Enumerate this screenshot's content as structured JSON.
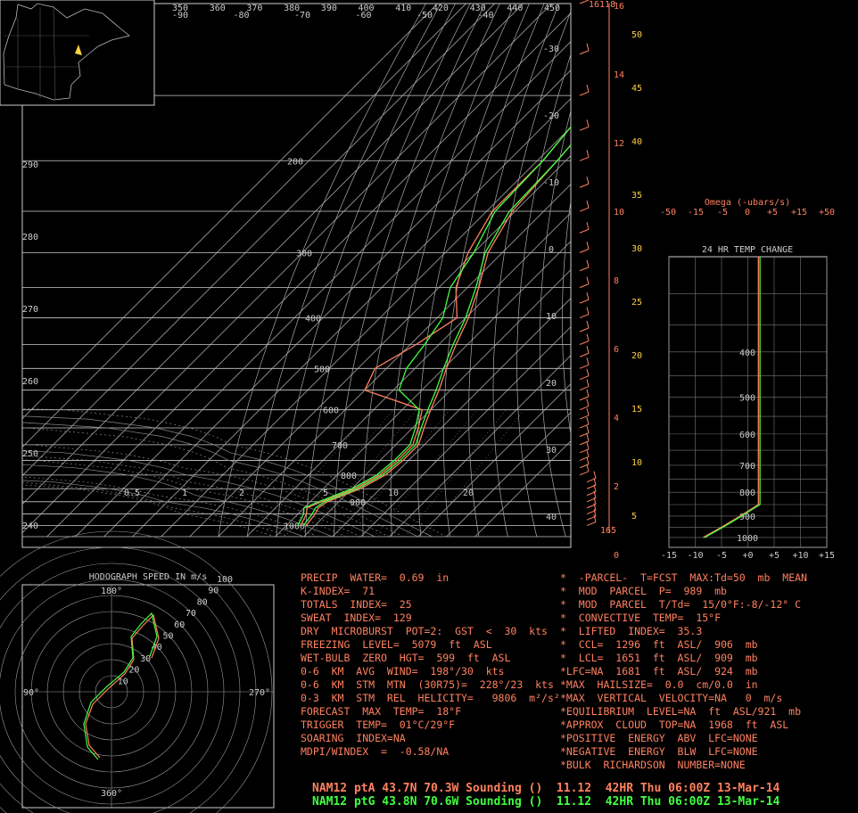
{
  "chart_data": [
    {
      "type": "line",
      "title": "",
      "kind": "skew-T log-P sounding",
      "top_temp_labels": [
        "350",
        "360",
        "370",
        "380",
        "390",
        "400",
        "410",
        "420",
        "430",
        "440",
        "450"
      ],
      "top_c_labels": [
        "-90",
        "-80",
        "-70",
        "-60",
        "-50",
        "-40"
      ],
      "theta_labels": [
        "290",
        "280",
        "270",
        "260",
        "250",
        "240"
      ],
      "pressure_labels": [
        "200",
        "300",
        "400",
        "500",
        "600",
        "700",
        "800",
        "900",
        "1000"
      ],
      "isotherm_labels": [
        "-30",
        "-20",
        "-10",
        "0",
        "10",
        "20",
        "30",
        "40"
      ],
      "mixing_ratio_labels": [
        "0.5",
        "1",
        "2",
        "5",
        "10",
        "20"
      ],
      "height_km": [
        "16",
        "14",
        "12",
        "10",
        "8",
        "6",
        "4",
        "2",
        "0"
      ],
      "height_kft": [
        "50",
        "45",
        "40",
        "35",
        "30",
        "25",
        "20",
        "15",
        "10",
        "5"
      ],
      "top_label": "16118",
      "bottom_label": "165",
      "pressure_levels": [
        1000,
        950,
        925,
        900,
        850,
        800,
        750,
        700,
        650,
        600,
        550,
        500,
        450,
        400,
        350,
        300,
        250,
        200,
        150,
        100
      ],
      "series": [
        {
          "name": "NAM12 ptA 43.7N 70.3W",
          "color": "#ff8060",
          "temperature_c": [
            -13,
            -14,
            -15,
            -14,
            -7,
            -3,
            -2,
            -2,
            -6,
            -10,
            -14,
            -19,
            -24,
            -29,
            -36,
            -45,
            -51,
            -53,
            -56,
            -58
          ],
          "dewpoint_c": [
            -15,
            -17,
            -19,
            -16,
            -9,
            -5,
            -4,
            -4,
            -8,
            -13,
            -40,
            -44,
            -38,
            -33,
            -44,
            -52,
            -58,
            -58,
            -62,
            -66
          ]
        },
        {
          "name": "NAM12 ptG 43.8N 70.6W",
          "color": "#40ff40",
          "temperature_c": [
            -14,
            -15,
            -16,
            -15,
            -8,
            -4,
            -3,
            -3,
            -7,
            -11,
            -15,
            -20,
            -25,
            -30,
            -37,
            -46,
            -52,
            -53,
            -56,
            -58
          ],
          "dewpoint_c": [
            -16,
            -18,
            -20,
            -17,
            -10,
            -6,
            -5,
            -5,
            -9,
            -14,
            -28,
            -33,
            -35,
            -38,
            -46,
            -50,
            -57,
            -58,
            -62,
            -66
          ]
        }
      ]
    },
    {
      "type": "line",
      "title": "24 HR TEMP CHANGE",
      "subtitle": "Omega (-ubars/s)",
      "omega_labels": [
        "-50",
        "-15",
        "-5",
        "0",
        "+5",
        "+15",
        "+50"
      ],
      "x_labels": [
        "-15",
        "-10",
        "-5",
        "+0",
        "+5",
        "+10",
        "+15"
      ],
      "y_labels": [
        "400",
        "500",
        "600",
        "700",
        "800",
        "900",
        "1000"
      ],
      "xlim": [
        -15,
        15
      ]
    },
    {
      "type": "scatter",
      "title": "HODOGRAPH SPEED IN m/s",
      "direction_labels": [
        "180°",
        "270°",
        "360°",
        "90°"
      ],
      "ring_labels": [
        "10",
        "20",
        "30",
        "40",
        "50",
        "60",
        "70",
        "80",
        "90",
        "100"
      ]
    }
  ],
  "indices": [
    "PRECIP  WATER=  0.69  in",
    "K-INDEX=  71",
    "TOTALS  INDEX=  25",
    "SWEAT  INDEX=  129",
    "DRY  MICROBURST  POT=2:  GST  <  30  kts",
    "FREEZING  LEVEL=  5079  ft  ASL",
    "WET-BULB  ZERO  HGT=  599  ft  ASL",
    "0-6  KM  AVG  WIND=  198°/30  kts",
    "0-6  KM  STM  MTN  (30R75)=  228°/23  kts",
    "0-3  KM  STM  REL  HELICITY=   9806  m²/s²",
    "FORECAST  MAX  TEMP=  18°F",
    "TRIGGER  TEMP=  01°C/29°F",
    "SOARING  INDEX=NA",
    "MDPI/WINDEX  =  -0.58/NA"
  ],
  "parcel": [
    "*  -PARCEL-  T=FCST  MAX:Td=50  mb  MEAN",
    "*  MOD  PARCEL  P=  989  mb",
    "*  MOD  PARCEL  T/Td=  15/0°F:-8/-12° C",
    "*  CONVECTIVE  TEMP=  15°F",
    "*  LIFTED  INDEX=  35.3",
    "*  CCL=  1296  ft  ASL/  906  mb",
    "*  LCL=  1651  ft  ASL/  909  mb",
    "*LFC=NA  1681  ft  ASL/  924  mb",
    "*MAX  HAILSIZE=  0.0  cm/0.0  in",
    "*MAX  VERTICAL  VELOCITY=NA   0  m/s",
    "*EQUILIBRIUM  LEVEL=NA  ft  ASL/921  mb",
    "*APPROX  CLOUD  TOP=NA  1968  ft  ASL",
    "*POSITIVE  ENERGY  ABV  LFC=NONE",
    "*NEGATIVE  ENERGY  BLW  LFC=NONE",
    "*BULK  RICHARDSON  NUMBER=NONE"
  ],
  "footer": {
    "line_a": "NAM12 ptA 43.7N 70.3W Sounding ()  11.12  42HR Thu 06:00Z 13-Mar-14",
    "line_g": "NAM12 ptG 43.8N 70.6W Sounding ()  11.12  42HR Thu 06:00Z 13-Mar-14"
  },
  "colors": {
    "accent_a": "#ff8060",
    "accent_g": "#40ff40",
    "grid": "#bbbbbb"
  }
}
